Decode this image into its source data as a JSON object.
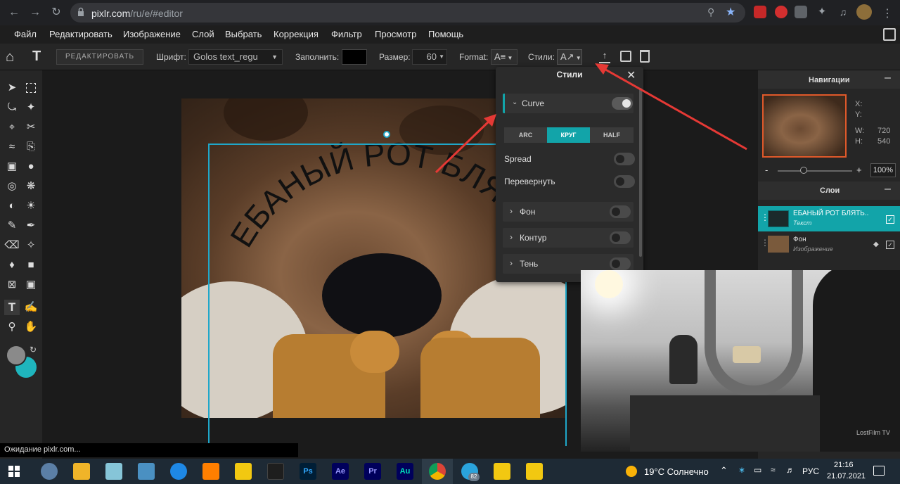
{
  "browser": {
    "url_host": "pixlr.com",
    "url_path": "/ru/e/#editor"
  },
  "menu": {
    "items": [
      "Файл",
      "Редактировать",
      "Изображение",
      "Слой",
      "Выбрать",
      "Коррекция",
      "Фильтр",
      "Просмотр",
      "Помощь"
    ]
  },
  "toolbar": {
    "edit_button": "РЕДАКТИРОВАТЬ",
    "font_label": "Шрифт:",
    "font_value": "Golos text_regu",
    "fill_label": "Заполнить:",
    "fill_color": "#000000",
    "size_label": "Размер:",
    "size_value": "60",
    "format_label": "Format:",
    "styles_label": "Стили:"
  },
  "canvas": {
    "curved_text": "ЕБАНЫЙ РОТ БЛЯТЬ"
  },
  "styles_panel": {
    "title": "Стили",
    "curve_label": "Curve",
    "curve_on": true,
    "modes": [
      "ARC",
      "КРУГ",
      "HALF"
    ],
    "active_mode": "КРУГ",
    "spread_label": "Spread",
    "flip_label": "Перевернуть",
    "sections": [
      "Фон",
      "Контур",
      "Тень"
    ]
  },
  "navigator": {
    "title": "Навигации",
    "x_label": "X:",
    "y_label": "Y:",
    "w_label": "W:",
    "w_value": "720",
    "h_label": "H:",
    "h_value": "540",
    "zoom_value": "100%",
    "zoom_minus": "-",
    "zoom_plus": "+"
  },
  "layers": {
    "title": "Слои",
    "items": [
      {
        "name": "ЕБАНЫЙ РОТ БЛЯТЬ..",
        "type": "Текст"
      },
      {
        "name": "Фон",
        "type": "Изображение"
      }
    ]
  },
  "video": {
    "watermark": "LostFilm TV"
  },
  "status_text": "Ожидание pixlr.com...",
  "taskbar": {
    "weather": "19°C  Солнечно",
    "lang": "РУС",
    "time": "21:16",
    "date": "21.07.2021",
    "telegram_badge": "82"
  },
  "colors": {
    "accent": "#12a4a9",
    "primary_color": "#8a8a8a",
    "secondary_color": "#1fb5bd",
    "arrow": "#e53935"
  }
}
